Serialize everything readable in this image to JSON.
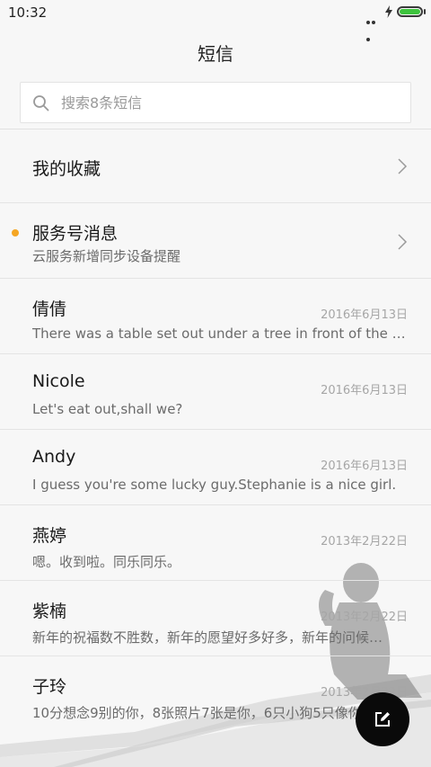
{
  "status_bar": {
    "time": "10:32",
    "battery_level": 1.0,
    "battery_color": "#3ec43e",
    "icons": [
      "more-dots-icon",
      "charging-bolt-icon",
      "battery-icon"
    ]
  },
  "header": {
    "title": "短信"
  },
  "search": {
    "placeholder": "搜索8条短信",
    "value": ""
  },
  "colors": {
    "unread_dot": "#f5a623",
    "fab_background": "#0a0a0a",
    "background": "#f7f7f7"
  },
  "list": {
    "favorites": {
      "title": "我的收藏"
    },
    "service": {
      "title": "服务号消息",
      "subtitle": "云服务新增同步设备提醒",
      "unread": true
    },
    "conversations": [
      {
        "name": "倩倩",
        "date": "2016年6月13日",
        "preview": "There was a table set out under a tree in front of the house…"
      },
      {
        "name": "Nicole",
        "date": "2016年6月13日",
        "preview": "Let's eat out,shall we?"
      },
      {
        "name": "Andy",
        "date": "2016年6月13日",
        "preview": "I guess you're some lucky guy.Stephanie is a nice girl."
      },
      {
        "name": "燕婷",
        "date": "2013年2月22日",
        "preview": "嗯。收到啦。同乐同乐。"
      },
      {
        "name": "紫楠",
        "date": "2013年2月22日",
        "preview": "新年的祝福数不胜数，新年的愿望好多好多，新年的问候…"
      },
      {
        "name": "子玲",
        "date": "2013年2月22日",
        "preview": "10分想念9别的你，8张照片7张是你，6只小狗5只像你…"
      }
    ]
  },
  "fab": {
    "icon": "compose-icon"
  }
}
